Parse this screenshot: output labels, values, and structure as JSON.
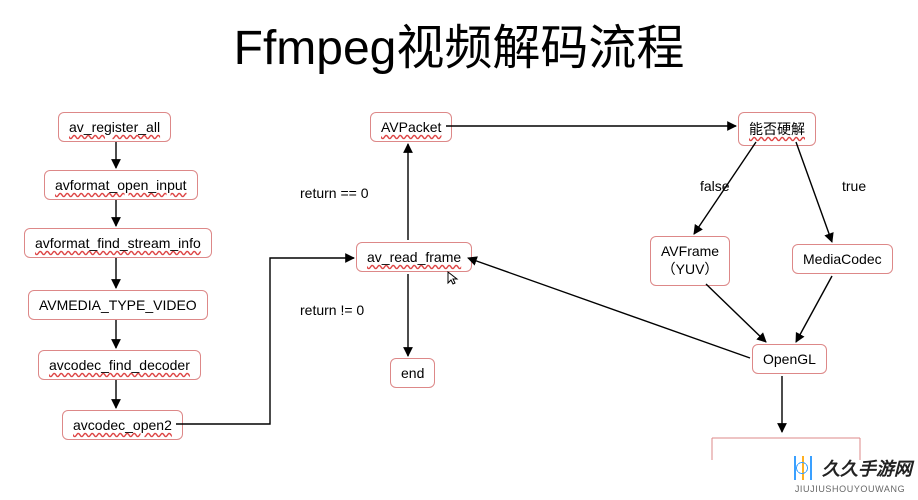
{
  "title": "Ffmpeg视频解码流程",
  "nodes": {
    "n1": "av_register_all",
    "n2": "avformat_open_input",
    "n3": "avformat_find_stream_info",
    "n4": "AVMEDIA_TYPE_VIDEO",
    "n5": "avcodec_find_decoder",
    "n6": "avcodec_open2",
    "p1": "AVPacket",
    "p2": "av_read_frame",
    "p3": "end",
    "hw": "能否硬解",
    "avf": "AVFrame\n（YUV）",
    "mc": "MediaCodec",
    "gl": "OpenGL"
  },
  "labels": {
    "ret0": "return == 0",
    "retn0": "return != 0",
    "false": "false",
    "true": "true"
  },
  "watermark": {
    "text": "久久手游网",
    "url": "JIUJIUSHOUYOUWANG"
  }
}
